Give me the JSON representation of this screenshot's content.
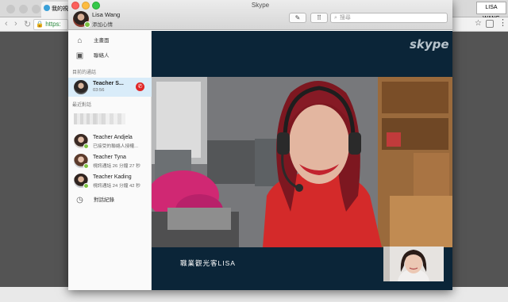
{
  "browser": {
    "tab_label": "我的視",
    "url_fragment": "https:",
    "user_badge": "LISA WANG"
  },
  "window": {
    "title": "Skype"
  },
  "profile": {
    "name": "Lisa Wang",
    "mood": "添加心情"
  },
  "search": {
    "placeholder": "搜尋"
  },
  "nav": {
    "home": "主畫面",
    "contacts": "聯絡人",
    "history": "對話紀錄"
  },
  "sections": {
    "current": "目前的通話",
    "recent": "最近對話"
  },
  "active_call": {
    "name": "Teacher S...",
    "duration": "03:56"
  },
  "recent": [
    {
      "name": "Teacher Andjela",
      "sub": "已接受的聯絡人授權..."
    },
    {
      "name": "Teacher Tyna",
      "sub": "視訊通話 26 分鐘 27 秒"
    },
    {
      "name": "Teacher Kading",
      "sub": "視訊通話 24 分鐘 42 秒"
    }
  ],
  "video": {
    "logo": "skype",
    "caption": "職業觀光客LISA"
  },
  "colors": {
    "video_bg": "#0b2538",
    "active_row": "#d9ecf9",
    "hangup": "#e02525",
    "online": "#7dc243"
  }
}
